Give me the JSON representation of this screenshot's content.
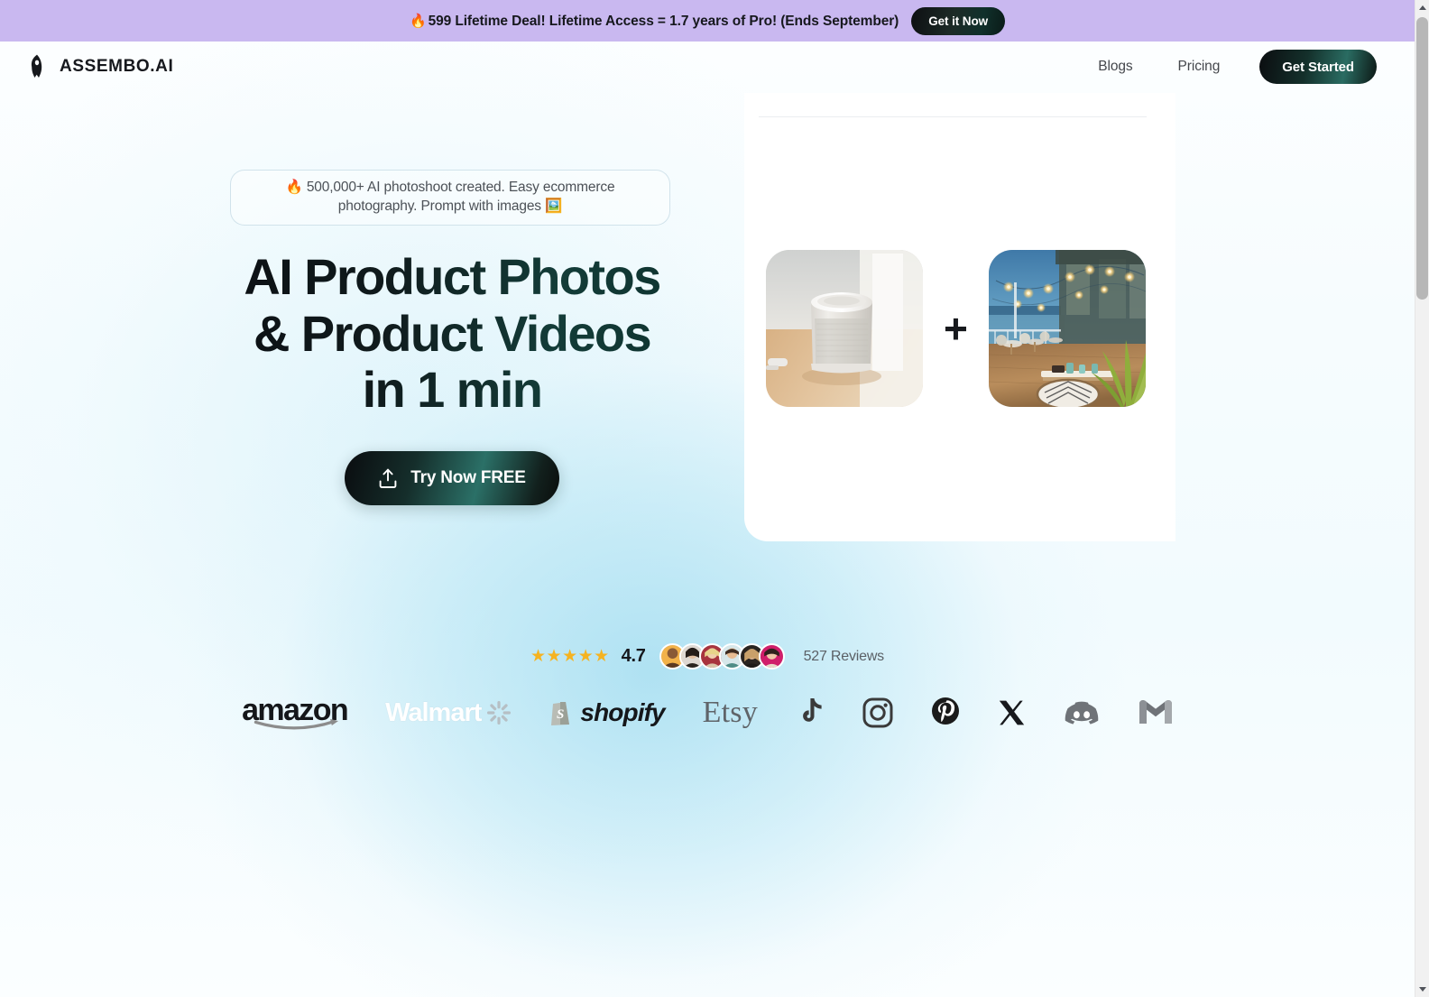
{
  "promo": {
    "flame": "🔥",
    "text": "599 Lifetime Deal! Lifetime Access = 1.7 years of Pro! (Ends September)",
    "cta_label": "Get it Now",
    "bg_color": "#c9b8f0"
  },
  "nav": {
    "logo_icon": "rocket-icon",
    "brand": "ASSEMBO.AI",
    "links": [
      {
        "label": "Blogs"
      },
      {
        "label": "Pricing"
      }
    ],
    "cta_label": "Get Started"
  },
  "hero": {
    "badge": "🔥 500,000+ AI photoshoot created. Easy ecommerce photography. Prompt with images 🖼️",
    "title_lines": [
      "AI Product Photos",
      "& Product Videos",
      "in 1 min"
    ],
    "cta_label": "Try Now FREE",
    "cta_icon": "upload-icon",
    "accent_color": "#133c38"
  },
  "showcase": {
    "left_image_alt": "white smart speaker on wooden table",
    "operator": "+",
    "right_image_alt": "seaside restaurant patio at dusk with string lights"
  },
  "social_proof": {
    "stars": "★★★★★",
    "star_count": 5,
    "star_color": "#f5b321",
    "rating": "4.7",
    "avatar_count": 6,
    "reviews_label": "527 Reviews"
  },
  "brand_logos": [
    {
      "name": "amazon",
      "label": "amazon"
    },
    {
      "name": "walmart",
      "label": "Walmart"
    },
    {
      "name": "shopify",
      "label": "shopify"
    },
    {
      "name": "etsy",
      "label": "Etsy"
    },
    {
      "name": "tiktok",
      "label": ""
    },
    {
      "name": "instagram",
      "label": ""
    },
    {
      "name": "pinterest",
      "label": ""
    },
    {
      "name": "x",
      "label": ""
    },
    {
      "name": "discord",
      "label": ""
    },
    {
      "name": "gmail",
      "label": ""
    }
  ]
}
